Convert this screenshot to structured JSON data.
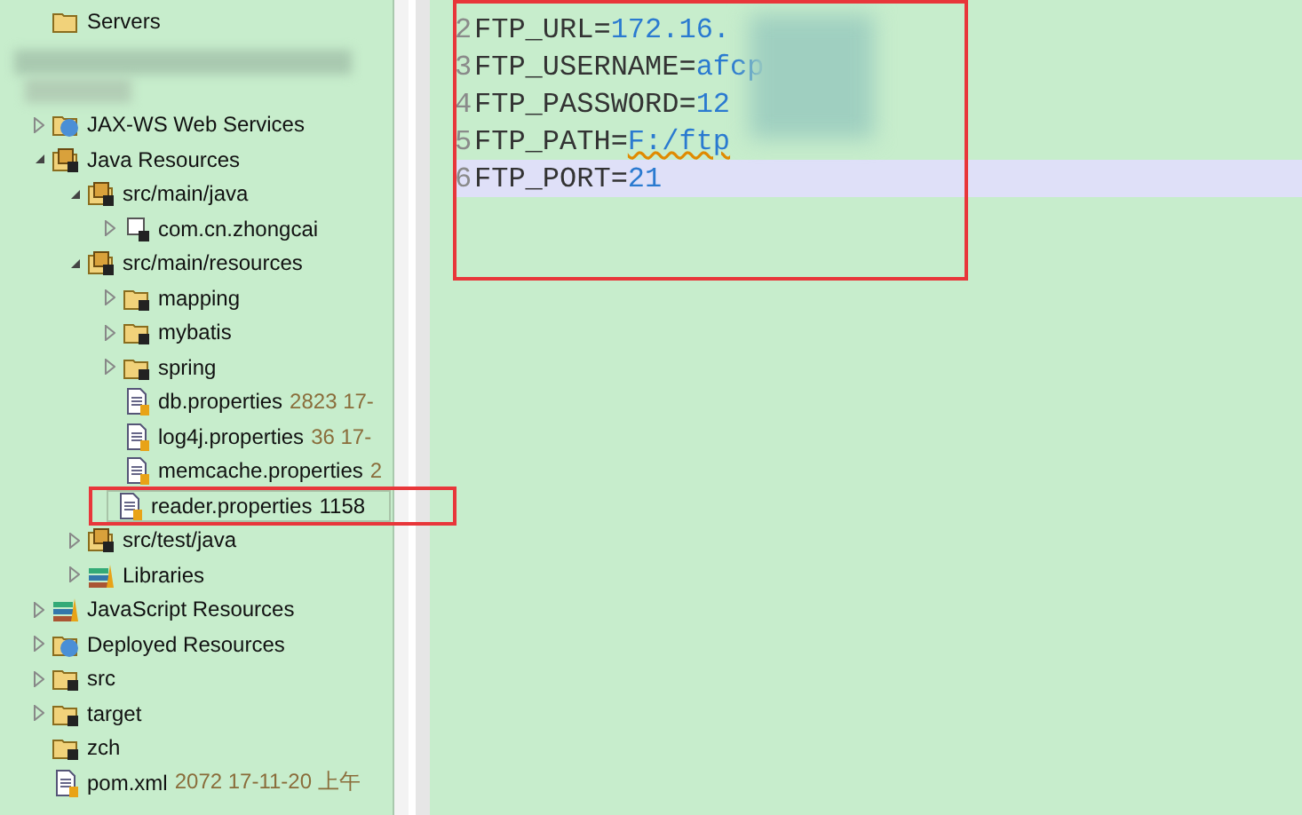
{
  "tree": [
    {
      "label": "Servers",
      "kind": "folder"
    },
    {
      "label": "JAX-WS Web Services",
      "kind": "webservice",
      "expanded": false
    },
    {
      "label": "Java Resources",
      "kind": "javares",
      "expanded": true,
      "children": [
        {
          "label": "src/main/java",
          "kind": "srcfolder",
          "expanded": true,
          "children": [
            {
              "label": "com.cn.zhongcai",
              "kind": "package",
              "expanded": false
            }
          ]
        },
        {
          "label": "src/main/resources",
          "kind": "srcfolder",
          "expanded": true,
          "children": [
            {
              "label": "mapping",
              "kind": "folder",
              "expanded": false
            },
            {
              "label": "mybatis",
              "kind": "folder",
              "expanded": false
            },
            {
              "label": "spring",
              "kind": "folder",
              "expanded": false
            },
            {
              "label": "db.properties",
              "kind": "file",
              "meta": "2823  17-"
            },
            {
              "label": "log4j.properties",
              "kind": "file",
              "meta": "36  17-"
            },
            {
              "label": "memcache.properties",
              "kind": "file",
              "meta": "2"
            },
            {
              "label": "reader.properties",
              "kind": "file",
              "meta": "1158",
              "selected": true
            }
          ]
        },
        {
          "label": "src/test/java",
          "kind": "srcfolder",
          "expanded": false
        },
        {
          "label": "Libraries",
          "kind": "library",
          "expanded": false
        }
      ]
    },
    {
      "label": "JavaScript Resources",
      "kind": "library",
      "expanded": false
    },
    {
      "label": "Deployed Resources",
      "kind": "deployed",
      "expanded": false
    },
    {
      "label": "src",
      "kind": "folder",
      "expanded": false
    },
    {
      "label": "target",
      "kind": "folder",
      "expanded": false
    },
    {
      "label": "zch",
      "kind": "folder"
    },
    {
      "label": "pom.xml",
      "kind": "xml",
      "meta": "2072  17-11-20 上午"
    }
  ],
  "editor": {
    "lines": [
      {
        "number": "2",
        "key": "FTP_URL=",
        "value": "172.16.",
        "current": false,
        "squiggle": false
      },
      {
        "number": "3",
        "key": "FTP_USERNAME=",
        "value": "afcp",
        "current": false,
        "squiggle": false
      },
      {
        "number": "4",
        "key": "FTP_PASSWORD=",
        "value": "12",
        "current": false,
        "squiggle": false
      },
      {
        "number": "5",
        "key": "FTP_PATH=",
        "value": "F:/ftp",
        "current": false,
        "squiggle": true
      },
      {
        "number": "6",
        "key": "FTP_PORT=",
        "value": "21",
        "current": true,
        "squiggle": false
      }
    ]
  }
}
